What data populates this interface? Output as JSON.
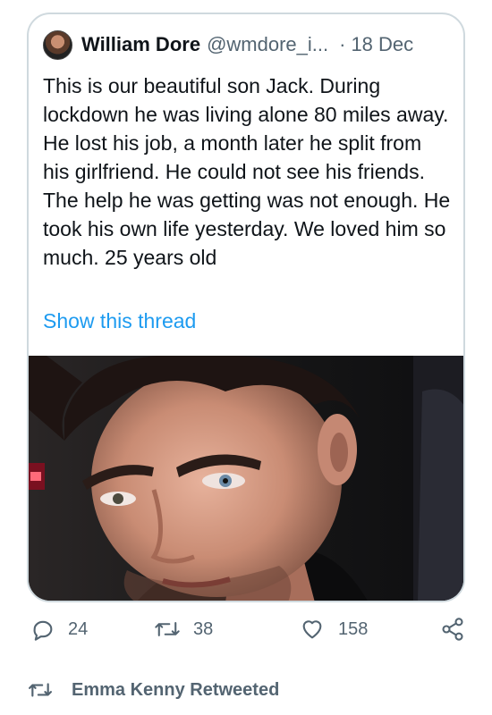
{
  "tweet": {
    "author": {
      "display_name": "William Dore",
      "handle": "@wmdore_i...",
      "avatar_icon": "avatar"
    },
    "separator": "·",
    "date": "18 Dec",
    "text": "This is our beautiful son Jack. During lockdown he was living alone 80 miles away. He lost his job, a month later he split from his girlfriend. He could not see his friends. The help he was getting was not enough. He took his own life yesterday. We loved him so much. 25 years old",
    "show_thread": "Show this thread",
    "media": "photo"
  },
  "actions": {
    "reply_count": "24",
    "retweet_count": "38",
    "like_count": "158",
    "reply_icon": "reply-icon",
    "retweet_icon": "retweet-icon",
    "like_icon": "heart-icon",
    "share_icon": "share-icon"
  },
  "retweet_notice": {
    "text": "Emma Kenny Retweeted",
    "icon": "retweet-icon"
  },
  "colors": {
    "link": "#1d9bf0",
    "secondary_text": "#536471",
    "border": "#cfd9de"
  }
}
